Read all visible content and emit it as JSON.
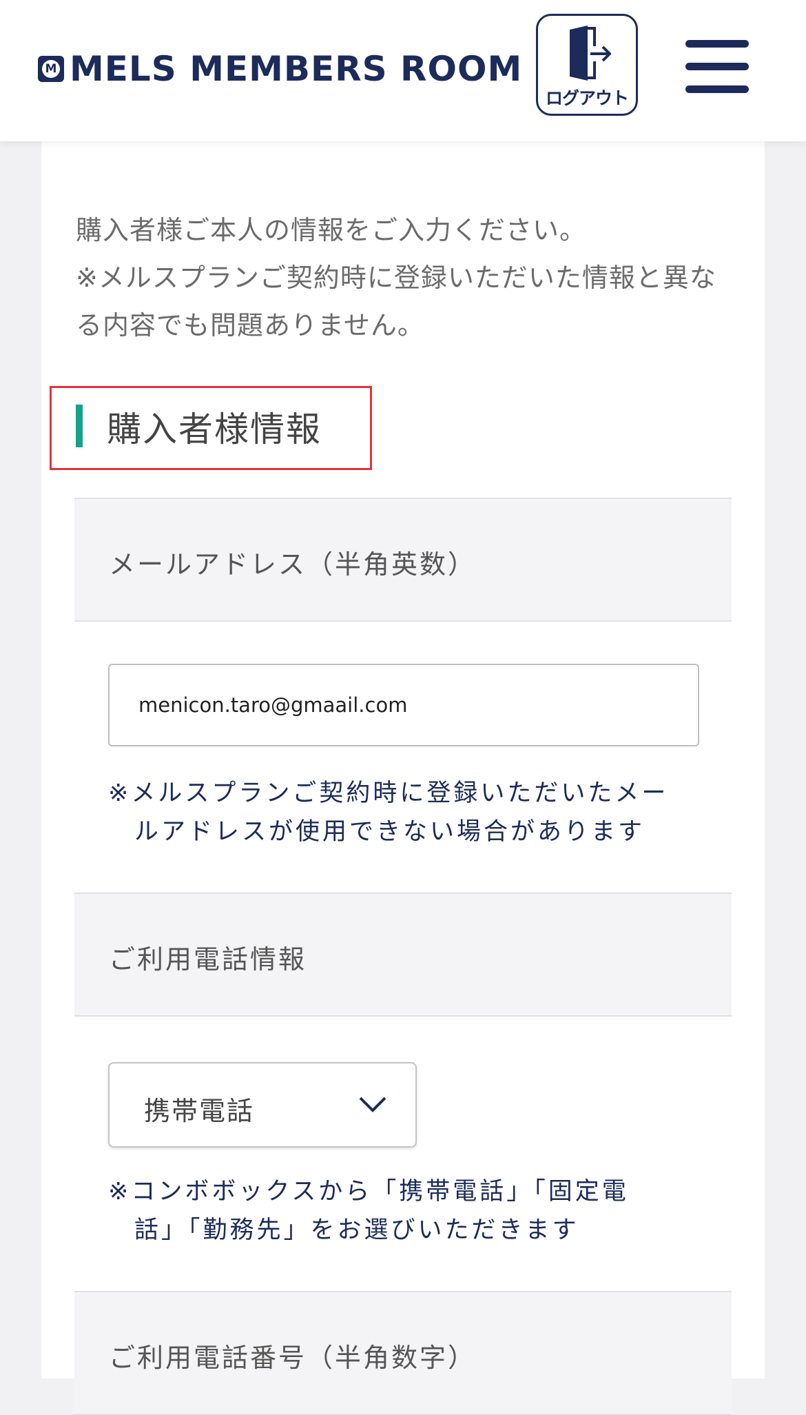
{
  "header": {
    "brand": "MELS MEMBERS ROOM",
    "brand_mark": "M",
    "logout_label": "ログアウト",
    "logout_icon": "door-exit-icon",
    "menu_icon": "hamburger-menu-icon"
  },
  "intro": {
    "line1": "購入者様ご本人の情報をご入力ください。",
    "line2": "※メルスプランご契約時に登録いただいた情報と異なる内容でも問題ありません。"
  },
  "section": {
    "title": "購入者様情報"
  },
  "email": {
    "label": "メールアドレス（半角英数）",
    "value": "menicon.taro@gmaail.com",
    "note_line1": "※メルスプランご契約時に登録いただいたメー",
    "note_line2": "ルアドレスが使用できない場合があります"
  },
  "phone_type": {
    "label": "ご利用電話情報",
    "selected": "携帯電話",
    "note_line1": "※コンボボックスから「携帯電話」「固定電",
    "note_line2": "話」「勤務先」をお選びいただきます"
  },
  "phone_number": {
    "label": "ご利用電話番号（半角数字）"
  },
  "colors": {
    "brand_navy": "#1c2b5a",
    "accent_green": "#10a58a",
    "highlight_red": "#e53138"
  }
}
